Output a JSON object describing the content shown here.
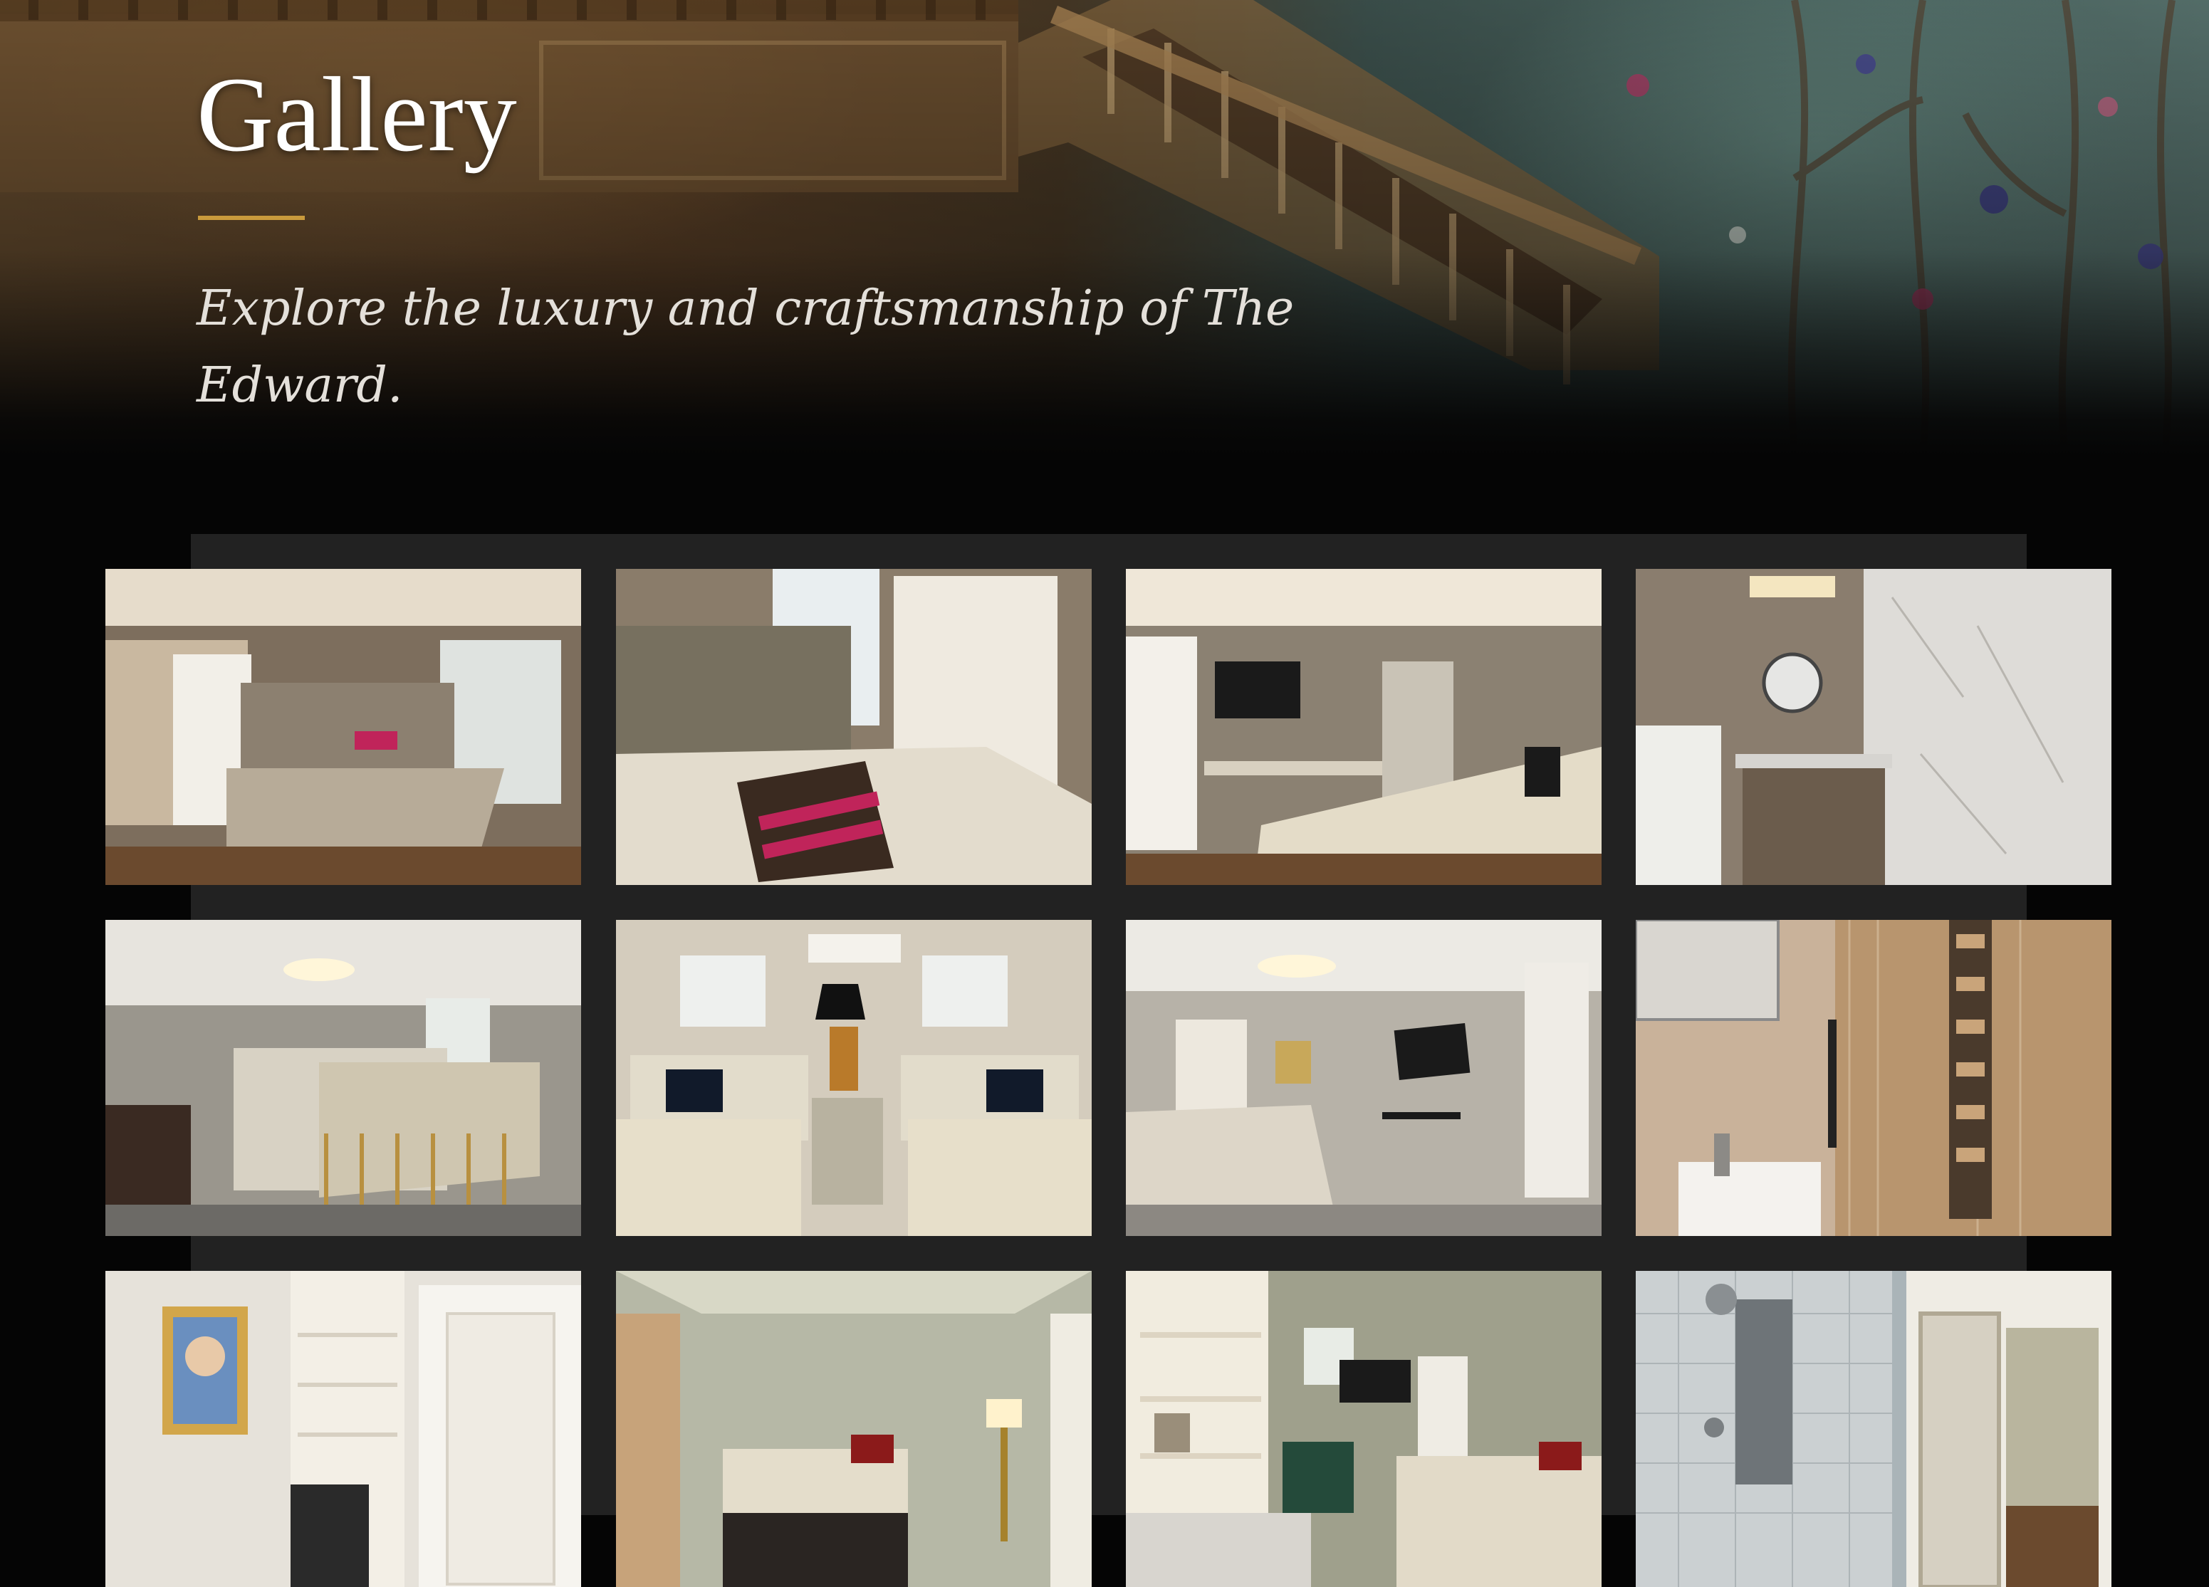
{
  "hero": {
    "title": "Gallery",
    "subtitle": "Explore the luxury and craftsmanship of The Edward.",
    "accent_color": "#c99a3c"
  },
  "gallery": {
    "photos": [
      {
        "subject": "guest room with upholstered queen bed and open bathroom door"
      },
      {
        "subject": "tufted headboard with striped accent pillow and wardrobe"
      },
      {
        "subject": "guest room with wall-mounted TV and writing desk"
      },
      {
        "subject": "bathroom vanity with round mirror and marble shower"
      },
      {
        "subject": "double room with brass-framed beds and chandelier"
      },
      {
        "subject": "two beds with monogram pillows and bedside lamp"
      },
      {
        "subject": "room with chandelier, TV and desk"
      },
      {
        "subject": "bathroom with glass shower and mosaic tile strip"
      },
      {
        "subject": "built-in shelving with framed portrait art"
      },
      {
        "subject": "green-walled room with bed and brass lamp"
      },
      {
        "subject": "room with built-in shelves, TV and green dresser"
      },
      {
        "subject": "glass-enclosed tiled shower with rain head"
      }
    ]
  }
}
